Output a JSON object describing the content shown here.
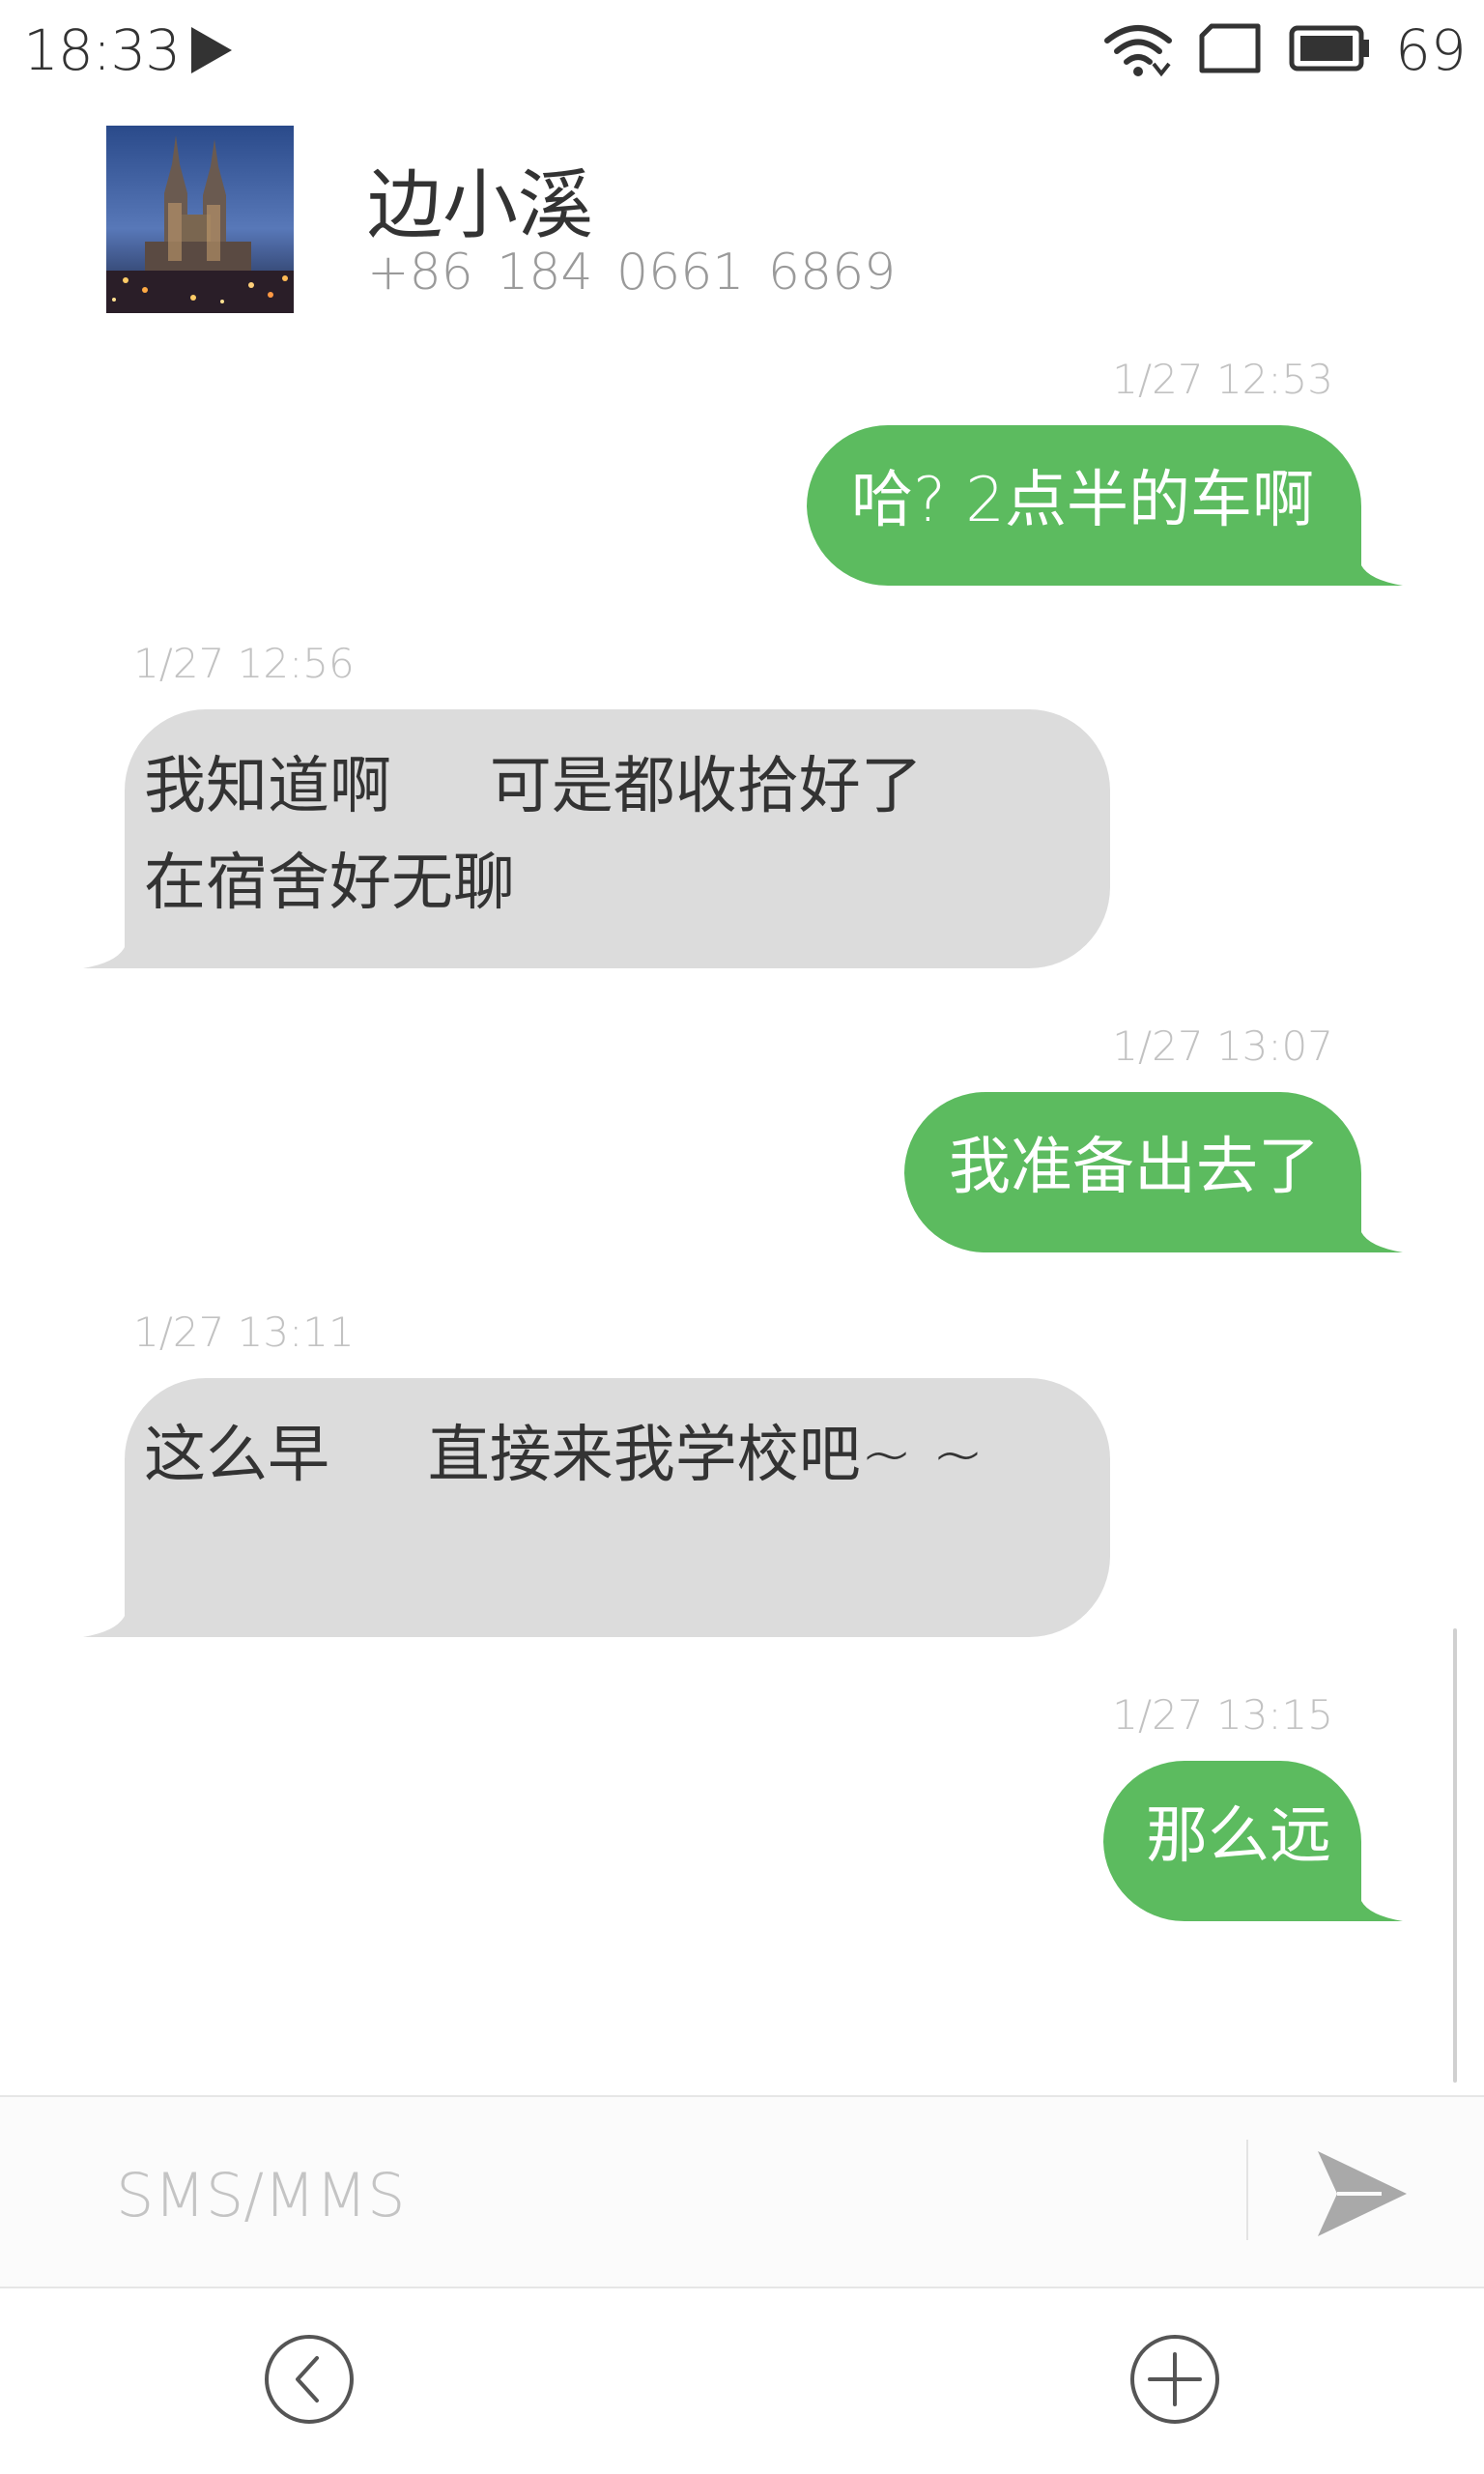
{
  "status_bar": {
    "time": "18:33",
    "battery_level": "69",
    "icons": [
      "play-icon",
      "wifi-icon",
      "sim-card-icon",
      "battery-icon"
    ]
  },
  "contact": {
    "name": "边小溪",
    "phone": "+86 184 0661 6869",
    "avatar": "cathedral-night-photo"
  },
  "messages": [
    {
      "direction": "sent",
      "timestamp": "1/27  12:53",
      "text": "哈? 2点半的车啊"
    },
    {
      "direction": "received",
      "timestamp": "1/27  12:56",
      "text": "我知道啊     可是都收拾好了\n在宿舍好无聊"
    },
    {
      "direction": "sent",
      "timestamp": "1/27  13:07",
      "text": "我准备出去了"
    },
    {
      "direction": "received",
      "timestamp": "1/27  13:11",
      "text": "这么早     直接来我学校吧~ ~"
    },
    {
      "direction": "sent",
      "timestamp": "1/27  13:15",
      "text": "那么远"
    }
  ],
  "composer": {
    "placeholder": "SMS/MMS",
    "value": "",
    "send_icon": "send-icon"
  },
  "navbar": {
    "back_icon": "back-icon",
    "add_icon": "add-icon"
  },
  "colors": {
    "sent_bubble": "#5cbb5f",
    "received_bubble": "#dcdcdc",
    "timestamp": "#c2c2c2",
    "text_dark": "#333333"
  }
}
